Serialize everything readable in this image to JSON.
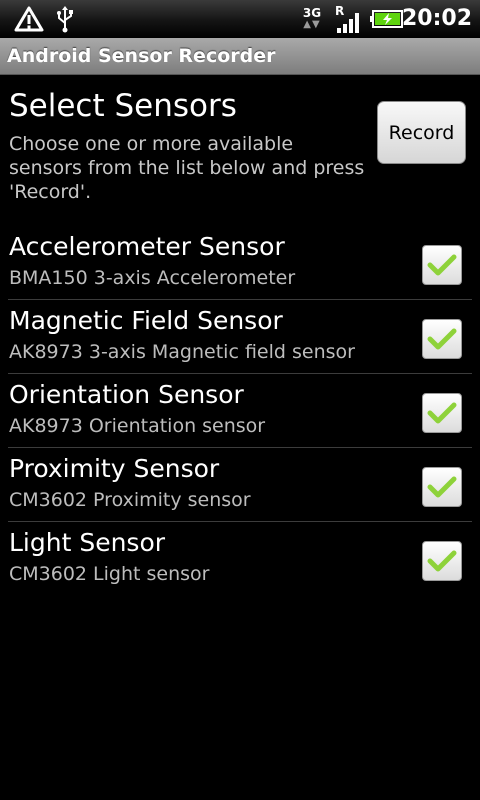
{
  "status_bar": {
    "time": "20:02",
    "network_type": "3G",
    "roaming_indicator": "R",
    "icons": [
      "warning-icon",
      "usb-icon",
      "network-3g-icon",
      "signal-icon",
      "battery-charging-icon"
    ]
  },
  "app": {
    "title": "Android Sensor Recorder"
  },
  "header": {
    "title": "Select Sensors",
    "description": "Choose one or more available sensors from the list below and press 'Record'.",
    "record_label": "Record"
  },
  "sensors": [
    {
      "name": "Accelerometer Sensor",
      "description": "BMA150 3-axis Accelerometer",
      "checked": true
    },
    {
      "name": "Magnetic Field Sensor",
      "description": "AK8973 3-axis Magnetic field sensor",
      "checked": true
    },
    {
      "name": "Orientation Sensor",
      "description": "AK8973 Orientation sensor",
      "checked": true
    },
    {
      "name": "Proximity Sensor",
      "description": "CM3602 Proximity sensor",
      "checked": true
    },
    {
      "name": "Light Sensor",
      "description": "CM3602 Light sensor",
      "checked": true
    }
  ],
  "colors": {
    "check_green": "#8ed23a",
    "battery_green": "#5fd40f"
  }
}
